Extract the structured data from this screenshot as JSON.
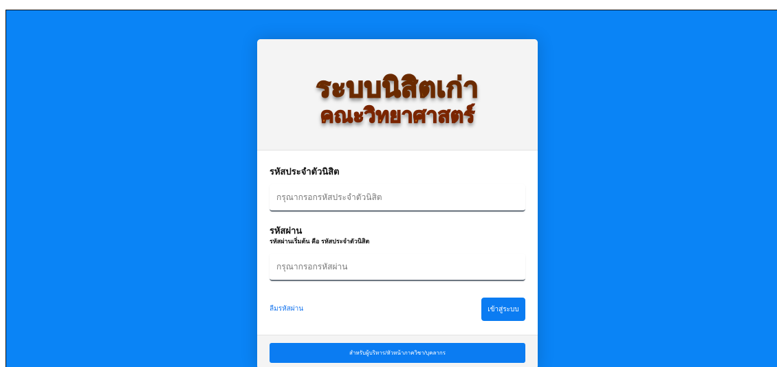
{
  "header": {
    "logo_line1": "ระบบนิสิตเก่า",
    "logo_line2": "คณะวิทยาศาสตร์"
  },
  "form": {
    "student_id": {
      "label": "รหัสประจำตัวนิสิต",
      "placeholder": "กรุณากรอกรหัสประจำตัวนิสิต",
      "value": ""
    },
    "password": {
      "label": "รหัสผ่าน",
      "hint": "รหัสผ่านเริ่มต้น คือ รหัสประจำตัวนิสิต",
      "placeholder": "กรุณากรอกรหัสผ่าน",
      "value": ""
    },
    "forgot_link": "ลืมรหัสผ่าน",
    "login_button": "เข้าสู่ระบบ"
  },
  "footer": {
    "admin_button": "สำหรับผู้บริหาร/หัวหน้าภาควิชา/บุคลากร"
  },
  "colors": {
    "background": "#0a84f6",
    "primary": "#0b7cf2",
    "logo_fill": "#ffc21a"
  }
}
